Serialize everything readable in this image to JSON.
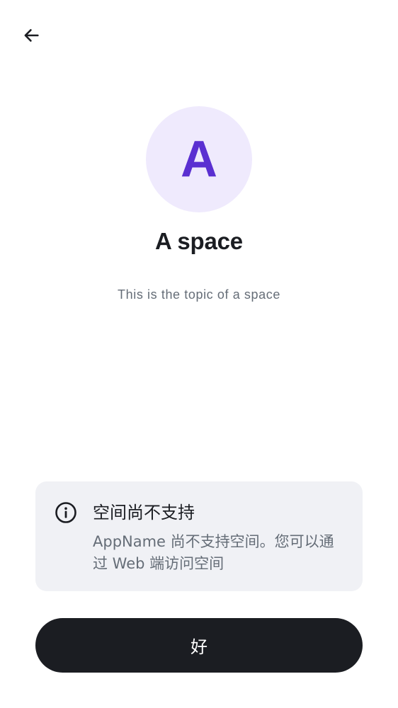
{
  "header": {
    "back_icon": "arrow-left-icon"
  },
  "space": {
    "avatar_letter": "A",
    "name": "A space",
    "topic": "This is the topic of a space"
  },
  "notice": {
    "icon": "info-icon",
    "title": "空间尚不支持",
    "body": "AppName 尚不支持空间。您可以通过 Web 端访问空间"
  },
  "actions": {
    "ok_label": "好"
  },
  "colors": {
    "avatar_bg": "#efeafd",
    "avatar_text": "#5a2fd1",
    "notice_bg": "#f0f1f5",
    "button_bg": "#1b1d22",
    "secondary_text": "#656d77"
  }
}
